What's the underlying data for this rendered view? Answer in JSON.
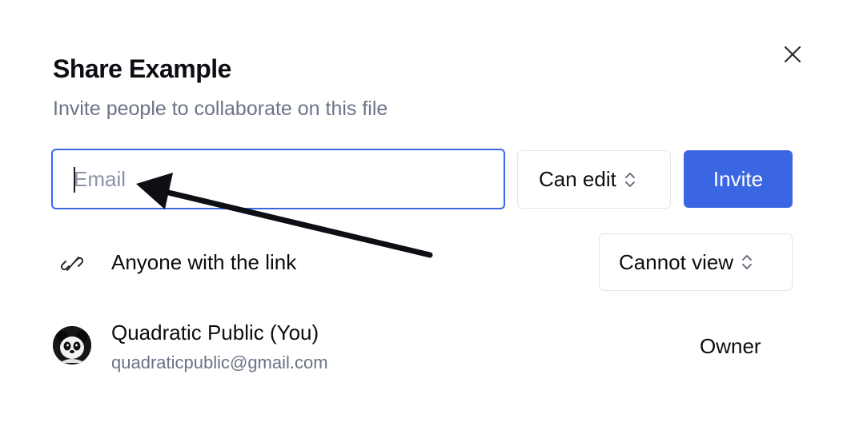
{
  "dialog": {
    "title": "Share Example",
    "subtitle": "Invite people to collaborate on this file",
    "close_icon": "close-icon"
  },
  "invite": {
    "email_placeholder": "Email",
    "email_value": "",
    "permission": "Can edit",
    "button_label": "Invite"
  },
  "link_sharing": {
    "icon": "link-off-icon",
    "label": "Anyone with the link",
    "permission": "Cannot view"
  },
  "users": [
    {
      "name": "Quadratic Public (You)",
      "email": "quadraticpublic@gmail.com",
      "role": "Owner",
      "avatar": "panda-avatar"
    }
  ],
  "colors": {
    "accent": "#3b66e3",
    "focus_border": "#3c68e6",
    "muted_text": "#6b7385",
    "border": "#e3e6ec"
  }
}
